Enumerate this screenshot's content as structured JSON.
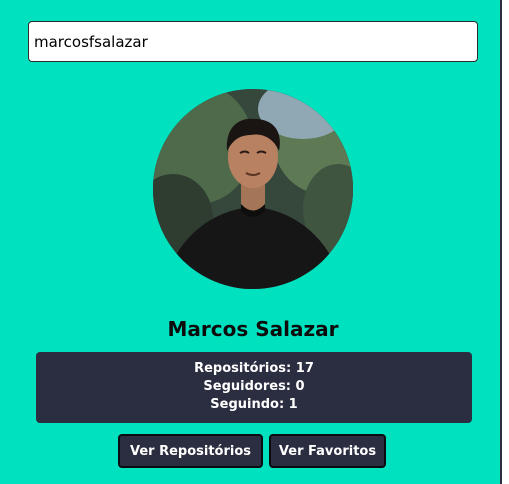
{
  "search": {
    "value": "marcosfsalazar"
  },
  "profile": {
    "avatar_icon": "user-avatar-photo",
    "name": "Marcos Salazar"
  },
  "stats": {
    "repositories": "Repositórios: 17",
    "followers": "Seguidores: 0",
    "following": "Seguindo: 1"
  },
  "actions": {
    "repos_label": "Ver Repositórios",
    "favorites_label": "Ver Favoritos"
  },
  "colors": {
    "background": "#00e1bf",
    "panel": "#2b2d41",
    "text_light": "#ffffff",
    "text_dark": "#0c0c0c"
  }
}
